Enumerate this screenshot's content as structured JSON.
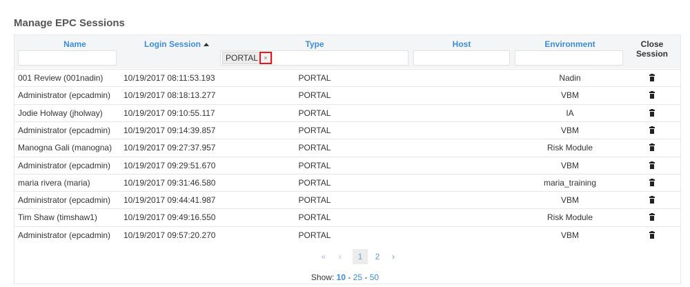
{
  "page": {
    "title": "Manage EPC Sessions"
  },
  "table": {
    "columns": {
      "name": "Name",
      "login_session": "Login Session",
      "type": "Type",
      "host": "Host",
      "environment": "Environment",
      "close_session": "Close Session"
    },
    "filters": {
      "type_tag": "PORTAL",
      "type_tag_remove": "×"
    },
    "rows": [
      {
        "name": "001 Review (001nadin)",
        "login": "10/19/2017 08:11:53.193",
        "type": "PORTAL",
        "host": "",
        "env": "Nadin"
      },
      {
        "name": "Administrator (epcadmin)",
        "login": "10/19/2017 08:18:13.277",
        "type": "PORTAL",
        "host": "",
        "env": "VBM"
      },
      {
        "name": "Jodie Holway (jholway)",
        "login": "10/19/2017 09:10:55.117",
        "type": "PORTAL",
        "host": "",
        "env": "IA"
      },
      {
        "name": "Administrator (epcadmin)",
        "login": "10/19/2017 09:14:39.857",
        "type": "PORTAL",
        "host": "",
        "env": "VBM"
      },
      {
        "name": "Manogna Gali (manogna)",
        "login": "10/19/2017 09:27:37.957",
        "type": "PORTAL",
        "host": "",
        "env": "Risk Module"
      },
      {
        "name": "Administrator (epcadmin)",
        "login": "10/19/2017 09:29:51.670",
        "type": "PORTAL",
        "host": "",
        "env": "VBM"
      },
      {
        "name": "maria rivera (maria)",
        "login": "10/19/2017 09:31:46.580",
        "type": "PORTAL",
        "host": "",
        "env": "maria_training"
      },
      {
        "name": "Administrator (epcadmin)",
        "login": "10/19/2017 09:44:41.987",
        "type": "PORTAL",
        "host": "",
        "env": "VBM"
      },
      {
        "name": "Tim Shaw (timshaw1)",
        "login": "10/19/2017 09:49:16.550",
        "type": "PORTAL",
        "host": "",
        "env": "Risk Module"
      },
      {
        "name": "Administrator (epcadmin)",
        "login": "10/19/2017 09:57:20.270",
        "type": "PORTAL",
        "host": "",
        "env": "VBM"
      }
    ]
  },
  "pagination": {
    "first": "«",
    "prev": "‹",
    "pages": [
      "1",
      "2"
    ],
    "current_page": "1",
    "next": "›",
    "show_label": "Show:",
    "page_sizes": [
      "10",
      "25",
      "50"
    ],
    "selected_size": "10",
    "separator": "-"
  },
  "colors": {
    "link": "#3c8dde",
    "highlight_border": "#e8141c",
    "filter_bg": "#f4f5f7"
  },
  "icons": {
    "close_session": "trash-icon",
    "sort": "sort-ascending-icon"
  }
}
